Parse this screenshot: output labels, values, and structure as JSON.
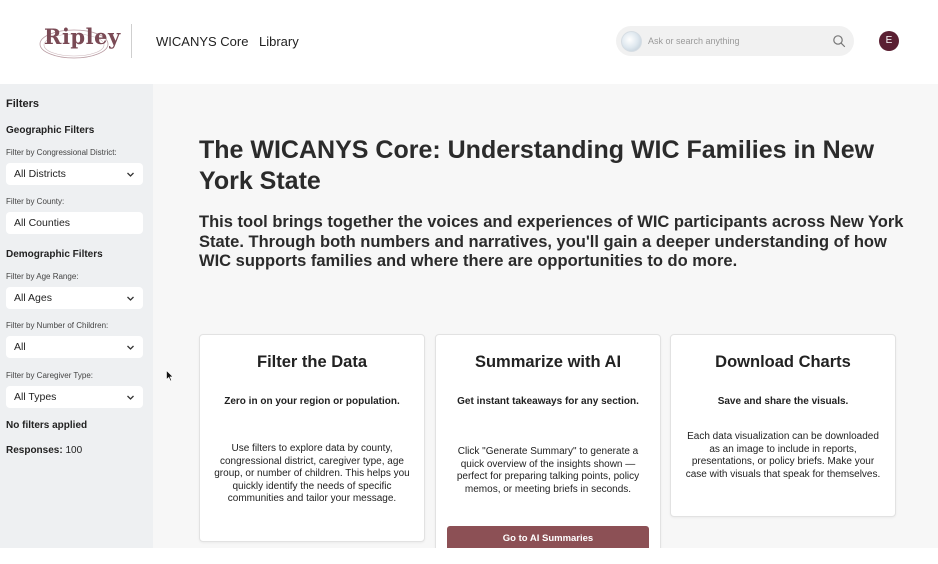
{
  "header": {
    "logo_text": "Ripley",
    "nav": {
      "core": "WICANYS Core",
      "library": "Library"
    },
    "search": {
      "placeholder": "Ask or search anything"
    },
    "avatar_initial": "E"
  },
  "sidebar": {
    "title": "Filters",
    "geo_heading": "Geographic Filters",
    "district": {
      "label": "Filter by Congressional District:",
      "value": "All Districts"
    },
    "county": {
      "label": "Filter by County:",
      "value": "All Counties"
    },
    "demo_heading": "Demographic Filters",
    "age": {
      "label": "Filter by Age Range:",
      "value": "All Ages"
    },
    "children": {
      "label": "Filter by Number of Children:",
      "value": "All"
    },
    "caregiver": {
      "label": "Filter by Caregiver Type:",
      "value": "All Types"
    },
    "status": "No filters applied",
    "responses_label": "Responses:",
    "responses_value": "100"
  },
  "main": {
    "title": "The WICANYS Core: Understanding WIC Families in New York State",
    "intro": "This tool brings together the voices and experiences of WIC participants across New York State. Through both numbers and narratives, you'll gain a deeper understanding of how WIC supports families and where there are opportunities to do more.",
    "cards": [
      {
        "title": "Filter the Data",
        "subtitle": "Zero in on your region or population.",
        "body": "Use filters to explore data by county, congressional district, caregiver type, age group, or number of children. This helps you quickly identify the needs of specific communities and tailor your message."
      },
      {
        "title": "Summarize with AI",
        "subtitle": "Get instant takeaways for any section.",
        "body": "Click \"Generate Summary\" to generate a quick overview of the insights shown — perfect for preparing talking points, policy memos, or meeting briefs in seconds.",
        "button": "Go to AI Summaries"
      },
      {
        "title": "Download Charts",
        "subtitle": "Save and share the visuals.",
        "body": "Each data visualization can be downloaded as an image to include in reports, presentations, or policy briefs. Make your case with visuals that speak for themselves."
      }
    ]
  },
  "colors": {
    "brand": "#7a4a55",
    "button": "#8c5055",
    "avatar": "#5a1f32",
    "sidebar_bg": "#eef0f2",
    "main_bg": "#f7f7f7"
  }
}
